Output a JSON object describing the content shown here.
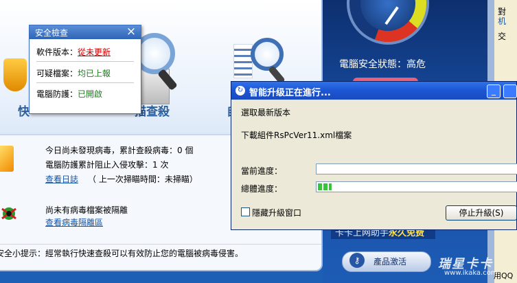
{
  "tools": {
    "quick_scan_label": "快",
    "full_scan_label": "描查殺",
    "custom_scan_label": "自"
  },
  "security_popup": {
    "title": "安全檢查",
    "close": "×",
    "rows": [
      {
        "label": "軟件版本：",
        "value": "從未更新"
      },
      {
        "label": "可疑檔案：",
        "value": "均已上報"
      },
      {
        "label": "電腦防護：",
        "value": "已開啟"
      }
    ]
  },
  "status": {
    "virus_line": "今日尚未發現病毒，累計查殺病毒：0 個",
    "block_line": "電腦防護累計阻止入侵攻擊：1 次",
    "view_log": "查看日誌",
    "last_scan": "（ 上一次掃瞄時間：未掃瞄）",
    "quarantine_line": "尚未有病毒檔案被隔離",
    "quarantine_link": "查看病毒隔離區",
    "tip": "安全小提示：經常執行快速查殺可以有效防止您的電腦被病毒侵害。"
  },
  "right_panel": {
    "pc_status": "電腦安全狀態：高危",
    "banner_text": "卡卡上网助手",
    "banner_highlight": "永久免费",
    "activate": "產品激活"
  },
  "far_right": {
    "line1": "對",
    "line2": "机",
    "line3": "交",
    "line4": "用QQ"
  },
  "watermark": {
    "logo": "瑞星卡卡",
    "url": "www.ikaka.com"
  },
  "upgrade_dialog": {
    "title": "智能升级正在進行...",
    "minimize": "_",
    "step1": "選取最新版本",
    "step2": "下載組件RsPcVer11.xml檔案",
    "current_label": "當前進度：",
    "total_label": "總體進度：",
    "current_progress": 0.0,
    "total_progress": 0.07,
    "hide_label": "隱藏升級窗口",
    "stop_button": "停止升級(S)"
  },
  "colors": {
    "accent": "#1c55d3",
    "danger": "#cc0000",
    "ok": "#1f7a1f",
    "progress": "#37c43b"
  }
}
